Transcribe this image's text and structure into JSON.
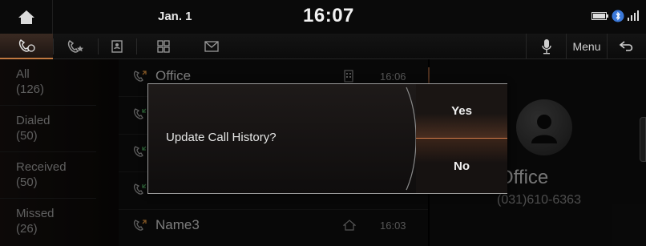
{
  "status_bar": {
    "date": "Jan. 1",
    "time": "16:07",
    "icons": [
      "home-icon",
      "battery-icon",
      "bluetooth-icon",
      "signal-icon"
    ]
  },
  "tabs": [
    {
      "icon": "recent-calls-icon",
      "active": true
    },
    {
      "icon": "favorites-icon",
      "active": false
    },
    {
      "icon": "contacts-icon",
      "active": false
    },
    {
      "icon": "keypad-icon",
      "active": false
    },
    {
      "icon": "messages-icon",
      "active": false
    }
  ],
  "toolbar": {
    "mic_icon": "microphone-icon",
    "menu_label": "Menu",
    "back_icon": "back-icon"
  },
  "categories": [
    {
      "label": "All",
      "count": "(126)"
    },
    {
      "label": "Dialed",
      "count": "(50)"
    },
    {
      "label": "Received",
      "count": "(50)"
    },
    {
      "label": "Missed",
      "count": "(26)"
    }
  ],
  "calls": [
    {
      "name": "Office",
      "type_icon": "office-phone-icon",
      "time": "16:06"
    },
    {
      "name": "",
      "type_icon": "",
      "time": ""
    },
    {
      "name": "",
      "type_icon": "",
      "time": ""
    },
    {
      "name": "",
      "type_icon": "",
      "time": ""
    },
    {
      "name": "Name3",
      "type_icon": "home-phone-icon",
      "time": "16:03"
    }
  ],
  "detail": {
    "name": "Office",
    "number": "(031)610-6363"
  },
  "dialog": {
    "message": "Update Call History?",
    "yes_label": "Yes",
    "no_label": "No"
  },
  "colors": {
    "accent": "#c07840",
    "background": "#000000",
    "dialog_border": "#9a9a9a"
  }
}
